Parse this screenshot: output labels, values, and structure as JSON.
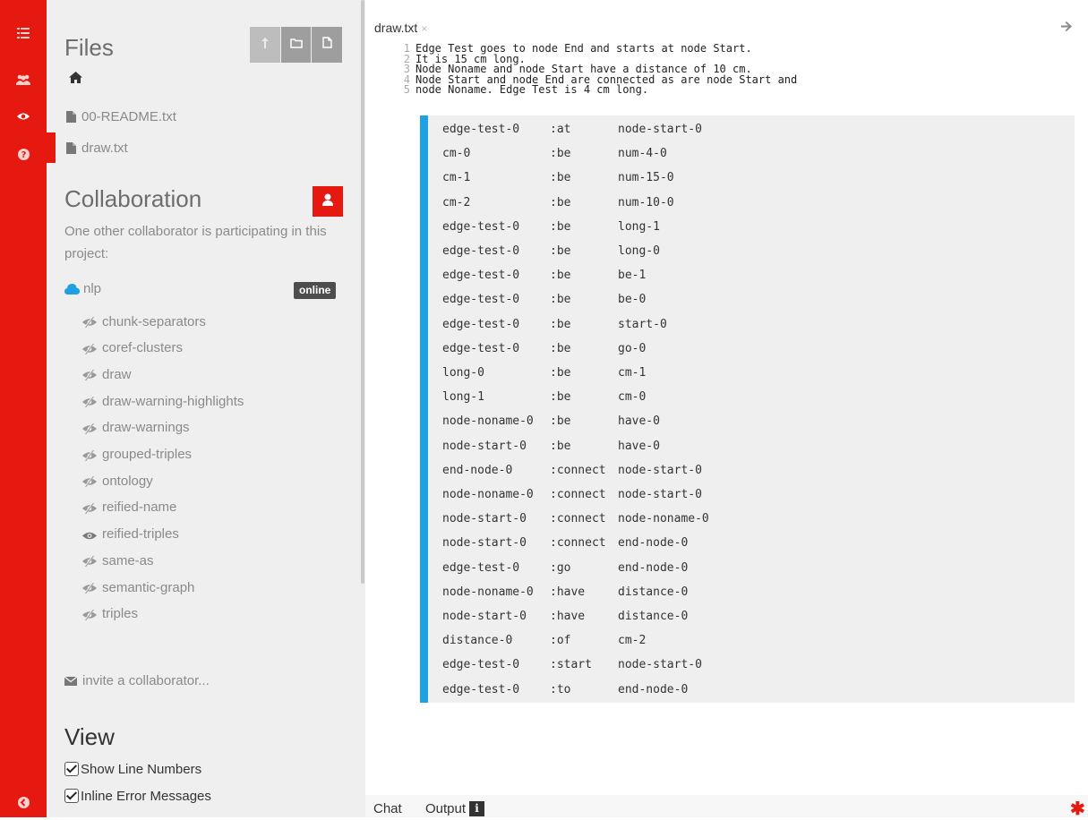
{
  "colors": {
    "accent": "#e5190f",
    "sidebar_bg": "#efefef",
    "output_bar": "#1da1e2",
    "badge_bg": "#4d4d4d"
  },
  "rail": {
    "items": [
      {
        "icon": "list-icon"
      },
      {
        "icon": "users-icon"
      },
      {
        "icon": "eye-icon"
      },
      {
        "icon": "question-icon"
      }
    ],
    "bottom_icon": "arrow-left-circle-icon"
  },
  "files": {
    "title": "Files",
    "toolbar_icons": [
      "upload-icon",
      "folder-icon",
      "file-icon"
    ],
    "home_icon": "home-icon",
    "items": [
      {
        "name": "00-README.txt",
        "active": false
      },
      {
        "name": "draw.txt",
        "active": true
      }
    ]
  },
  "collaboration": {
    "title": "Collaboration",
    "description": "One other collaborator is participating in this project:",
    "user": {
      "name": "nlp",
      "status": "online"
    },
    "layers": [
      {
        "name": "chunk-separators",
        "visible": false
      },
      {
        "name": "coref-clusters",
        "visible": false
      },
      {
        "name": "draw",
        "visible": false
      },
      {
        "name": "draw-warning-highlights",
        "visible": false
      },
      {
        "name": "draw-warnings",
        "visible": false
      },
      {
        "name": "grouped-triples",
        "visible": false
      },
      {
        "name": "ontology",
        "visible": false
      },
      {
        "name": "reified-name",
        "visible": false
      },
      {
        "name": "reified-triples",
        "visible": true
      },
      {
        "name": "same-as",
        "visible": false
      },
      {
        "name": "semantic-graph",
        "visible": false
      },
      {
        "name": "triples",
        "visible": false
      }
    ],
    "invite": "invite a collaborator..."
  },
  "view": {
    "title": "View",
    "options": [
      {
        "label": "Show Line Numbers",
        "checked": true
      },
      {
        "label": "Inline Error Messages",
        "checked": true
      }
    ]
  },
  "editor": {
    "tab": {
      "label": "draw.txt",
      "close": "×"
    },
    "lines": [
      {
        "n": "1",
        "text": "Edge Test goes to node End and starts at node Start."
      },
      {
        "n": "2",
        "text": "It is 15 cm long."
      },
      {
        "n": "3",
        "text": "Node Noname and node Start have a distance of 10 cm."
      },
      {
        "n": "4",
        "text": "Node Start and node End are connected as are node Start and"
      },
      {
        "n": "5",
        "text": "node Noname. Edge Test is 4 cm long."
      }
    ],
    "triples": [
      [
        "edge-test-0",
        ":at",
        "node-start-0"
      ],
      [
        "cm-0",
        ":be",
        "num-4-0"
      ],
      [
        "cm-1",
        ":be",
        "num-15-0"
      ],
      [
        "cm-2",
        ":be",
        "num-10-0"
      ],
      [
        "edge-test-0",
        ":be",
        "long-1"
      ],
      [
        "edge-test-0",
        ":be",
        "long-0"
      ],
      [
        "edge-test-0",
        ":be",
        "be-1"
      ],
      [
        "edge-test-0",
        ":be",
        "be-0"
      ],
      [
        "edge-test-0",
        ":be",
        "start-0"
      ],
      [
        "edge-test-0",
        ":be",
        "go-0"
      ],
      [
        "long-0",
        ":be",
        "cm-1"
      ],
      [
        "long-1",
        ":be",
        "cm-0"
      ],
      [
        "node-noname-0",
        ":be",
        "have-0"
      ],
      [
        "node-start-0",
        ":be",
        "have-0"
      ],
      [
        "end-node-0",
        ":connect",
        "node-start-0"
      ],
      [
        "node-noname-0",
        ":connect",
        "node-start-0"
      ],
      [
        "node-start-0",
        ":connect",
        "node-noname-0"
      ],
      [
        "node-start-0",
        ":connect",
        "end-node-0"
      ],
      [
        "edge-test-0",
        ":go",
        "end-node-0"
      ],
      [
        "node-noname-0",
        ":have",
        "distance-0"
      ],
      [
        "node-start-0",
        ":have",
        "distance-0"
      ],
      [
        "distance-0",
        ":of",
        "cm-2"
      ],
      [
        "edge-test-0",
        ":start",
        "node-start-0"
      ],
      [
        "edge-test-0",
        ":to",
        "end-node-0"
      ]
    ]
  },
  "bottom": {
    "chat": "Chat",
    "output": "Output",
    "info": "i",
    "star": "✱"
  }
}
